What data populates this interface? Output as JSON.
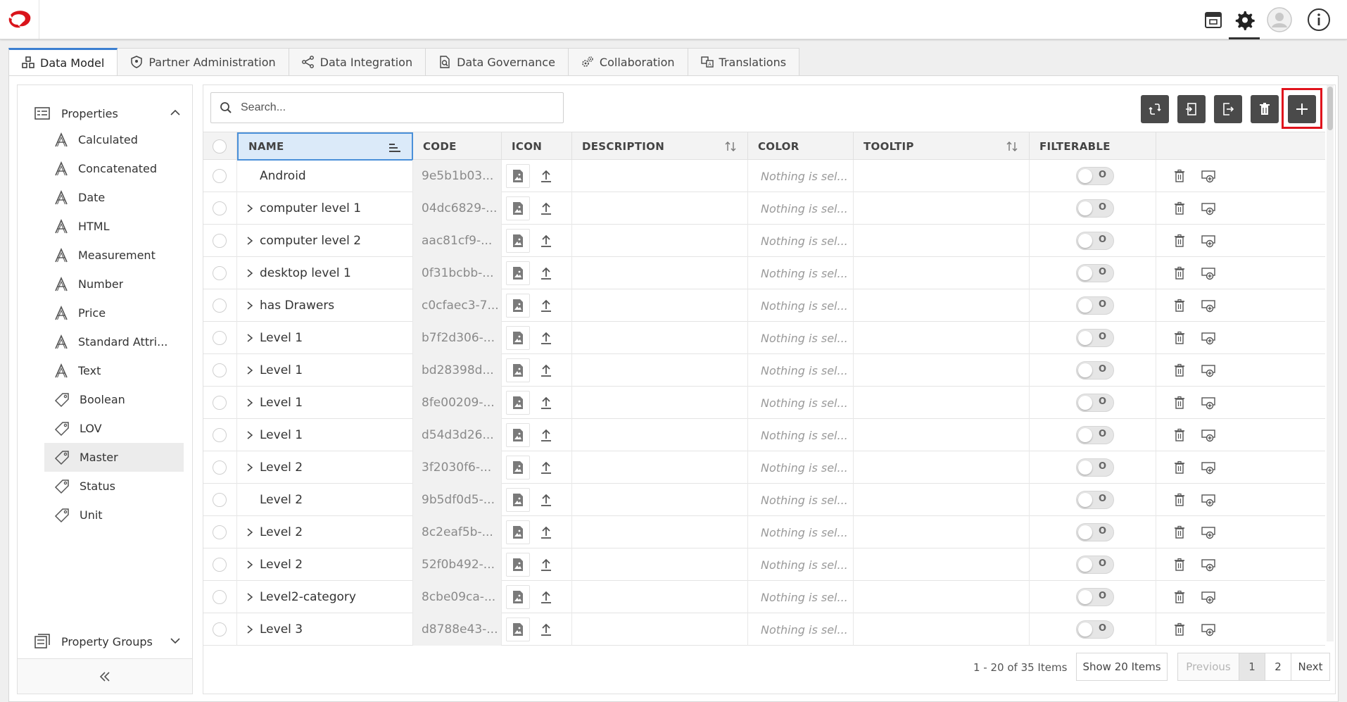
{
  "tabs": [
    {
      "label": "Data Model",
      "icon": "cubes-icon",
      "active": true
    },
    {
      "label": "Partner Administration",
      "icon": "shield-icon"
    },
    {
      "label": "Data Integration",
      "icon": "share-nodes-icon"
    },
    {
      "label": "Data Governance",
      "icon": "document-search-icon"
    },
    {
      "label": "Collaboration",
      "icon": "gears-icon"
    },
    {
      "label": "Translations",
      "icon": "translate-icon"
    }
  ],
  "sidebar": {
    "properties_label": "Properties",
    "items": [
      {
        "label": "Calculated",
        "icon": "attribute-icon"
      },
      {
        "label": "Concatenated",
        "icon": "attribute-icon"
      },
      {
        "label": "Date",
        "icon": "attribute-icon"
      },
      {
        "label": "HTML",
        "icon": "attribute-icon"
      },
      {
        "label": "Measurement",
        "icon": "attribute-icon"
      },
      {
        "label": "Number",
        "icon": "attribute-icon"
      },
      {
        "label": "Price",
        "icon": "attribute-icon"
      },
      {
        "label": "Standard Attri...",
        "icon": "attribute-icon"
      },
      {
        "label": "Text",
        "icon": "attribute-icon"
      },
      {
        "label": "Boolean",
        "icon": "tag-icon"
      },
      {
        "label": "LOV",
        "icon": "tag-icon"
      },
      {
        "label": "Master",
        "icon": "tag-icon",
        "selected": true
      },
      {
        "label": "Status",
        "icon": "tag-icon"
      },
      {
        "label": "Unit",
        "icon": "tag-icon"
      }
    ],
    "property_groups_label": "Property Groups"
  },
  "search": {
    "placeholder": "Search..."
  },
  "table": {
    "columns": {
      "name": "NAME",
      "code": "CODE",
      "icon": "ICON",
      "description": "DESCRIPTION",
      "color": "COLOR",
      "tooltip": "TOOLTIP",
      "filterable": "FILTERABLE"
    },
    "rows": [
      {
        "name": "Android",
        "expandable": false,
        "code": "9e5b1b03...",
        "color": "Nothing is sel...",
        "toggle": "O"
      },
      {
        "name": "computer level 1",
        "expandable": true,
        "code": "04dc6829-...",
        "color": "Nothing is sel...",
        "toggle": "O"
      },
      {
        "name": "computer level 2",
        "expandable": true,
        "code": "aac81cf9-...",
        "color": "Nothing is sel...",
        "toggle": "O"
      },
      {
        "name": "desktop level 1",
        "expandable": true,
        "code": "0f31bcbb-...",
        "color": "Nothing is sel...",
        "toggle": "O"
      },
      {
        "name": "has Drawers",
        "expandable": true,
        "code": "c0cfaec3-7...",
        "color": "Nothing is sel...",
        "toggle": "O"
      },
      {
        "name": "Level 1",
        "expandable": true,
        "code": "b7f2d306-...",
        "color": "Nothing is sel...",
        "toggle": "O"
      },
      {
        "name": "Level 1",
        "expandable": true,
        "code": "bd28398d...",
        "color": "Nothing is sel...",
        "toggle": "O"
      },
      {
        "name": "Level 1",
        "expandable": true,
        "code": "8fe00209-...",
        "color": "Nothing is sel...",
        "toggle": "O"
      },
      {
        "name": "Level 1",
        "expandable": true,
        "code": "d54d3d26...",
        "color": "Nothing is sel...",
        "toggle": "O"
      },
      {
        "name": "Level 2",
        "expandable": true,
        "code": "3f2030f6-...",
        "color": "Nothing is sel...",
        "toggle": "O"
      },
      {
        "name": "Level 2",
        "expandable": false,
        "code": "9b5df0d5-...",
        "color": "Nothing is sel...",
        "toggle": "O"
      },
      {
        "name": "Level 2",
        "expandable": true,
        "code": "8c2eaf5b-...",
        "color": "Nothing is sel...",
        "toggle": "O"
      },
      {
        "name": "Level 2",
        "expandable": true,
        "code": "52f0b492-...",
        "color": "Nothing is sel...",
        "toggle": "O"
      },
      {
        "name": "Level2-category",
        "expandable": true,
        "code": "8cbe09ca-...",
        "color": "Nothing is sel...",
        "toggle": "O"
      },
      {
        "name": "Level 3",
        "expandable": true,
        "code": "d8788e43-...",
        "color": "Nothing is sel...",
        "toggle": "O"
      }
    ]
  },
  "pagination": {
    "info": "1 - 20 of 35 Items",
    "show_items": "Show 20 Items",
    "previous": "Previous",
    "pages": [
      "1",
      "2"
    ],
    "current_page": "1",
    "next": "Next"
  },
  "colors": {
    "accent": "#3b7fd1",
    "highlight": "#e0131c",
    "toolbar_button": "#4a4a4a",
    "logo": "#d9141b"
  }
}
